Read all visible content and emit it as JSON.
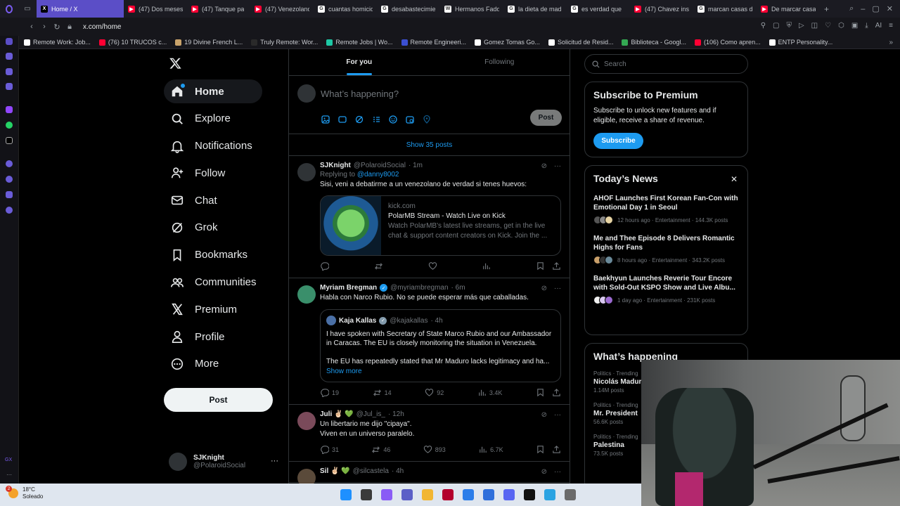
{
  "browser": {
    "tabs": [
      {
        "label": "Home / X",
        "color": "#000000",
        "glyph": "X",
        "active": true
      },
      {
        "label": "(47) Dos meses",
        "color": "#ff0033",
        "glyph": "▶",
        "active": false
      },
      {
        "label": "(47) Tanque pa",
        "color": "#ff0033",
        "glyph": "▶",
        "active": false
      },
      {
        "label": "(47) Venezolano",
        "color": "#ff0033",
        "glyph": "▶",
        "active": false
      },
      {
        "label": "cuantas homicid",
        "color": "#ffffff",
        "glyph": "G",
        "active": false
      },
      {
        "label": "desabastecimie",
        "color": "#ffffff",
        "glyph": "G",
        "active": false
      },
      {
        "label": "Hermanos Fadd",
        "color": "#ffffff",
        "glyph": "W",
        "active": false
      },
      {
        "label": "la dieta de mad",
        "color": "#ffffff",
        "glyph": "G",
        "active": false
      },
      {
        "label": "es verdad que",
        "color": "#ffffff",
        "glyph": "G",
        "active": false
      },
      {
        "label": "(47) Chavez ins",
        "color": "#ff0033",
        "glyph": "▶",
        "active": false
      },
      {
        "label": "marcan casas d",
        "color": "#ffffff",
        "glyph": "G",
        "active": false
      },
      {
        "label": "De marcar casas",
        "color": "#ff0033",
        "glyph": "▶",
        "active": false
      }
    ],
    "url": "x.com/home",
    "bookmarks": [
      {
        "label": "Remote Work: Job...",
        "color": "#ffffff"
      },
      {
        "label": "(76) 10 TRUCOS c...",
        "color": "#ff0033"
      },
      {
        "label": "19 Divine French L...",
        "color": "#c9a36b"
      },
      {
        "label": "Truly Remote: Wor...",
        "color": "#2a2a2a"
      },
      {
        "label": "Remote Jobs | Wo...",
        "color": "#1ec8a5"
      },
      {
        "label": "Remote Engineeri...",
        "color": "#3b4fd1"
      },
      {
        "label": "Gomez Tomas Go...",
        "color": "#ffffff"
      },
      {
        "label": "Solicitud de Resid...",
        "color": "#ffffff"
      },
      {
        "label": "Biblioteca - Googl...",
        "color": "#34a853"
      },
      {
        "label": "(106) Como apren...",
        "color": "#ff0033"
      },
      {
        "label": "ENTP Personality...",
        "color": "#ffffff"
      }
    ]
  },
  "nav": {
    "items": [
      {
        "label": "Home",
        "icon": "home-icon",
        "active": true,
        "dot": true
      },
      {
        "label": "Explore",
        "icon": "search-icon"
      },
      {
        "label": "Notifications",
        "icon": "bell-icon"
      },
      {
        "label": "Follow",
        "icon": "person-plus-icon"
      },
      {
        "label": "Chat",
        "icon": "mail-icon"
      },
      {
        "label": "Grok",
        "icon": "grok-icon"
      },
      {
        "label": "Bookmarks",
        "icon": "bookmark-icon"
      },
      {
        "label": "Communities",
        "icon": "people-icon"
      },
      {
        "label": "Premium",
        "icon": "x-icon"
      },
      {
        "label": "Profile",
        "icon": "person-icon"
      },
      {
        "label": "More",
        "icon": "more-circle-icon"
      }
    ],
    "post_label": "Post",
    "account": {
      "name": "SJKnight",
      "handle": "@PolaroidSocial",
      "more": "···"
    }
  },
  "feed": {
    "tabs": [
      "For you",
      "Following"
    ],
    "composer": {
      "placeholder": "What’s happening?",
      "post_label": "Post"
    },
    "show_more": "Show 35 posts",
    "posts": [
      {
        "name": "SJKnight",
        "handle": "@PolaroidSocial",
        "time": "· 1m",
        "avatar": "#2f3336",
        "reply_prefix": "Replying to ",
        "reply_to": "@danny8002",
        "text": "Sisi, veni a debatirme a un venezolano de verdad si tenes huevos:",
        "card": {
          "domain": "kick.com",
          "title": "PolarMB Stream - Watch Live on Kick",
          "desc": "Watch PolarMB's latest live streams, get in the live chat & support content creators on Kick. Join the ..."
        },
        "stats": {
          "reply": "",
          "repost": "",
          "like": "",
          "views": ""
        }
      },
      {
        "name": "Myriam Bregman",
        "handle": "@myriambregman",
        "time": "· 6m",
        "avatar": "#3a8f6b",
        "verified": true,
        "text": "Habla con Narco Rubio. No se puede esperar más que caballadas.",
        "quote": {
          "name": "Kaja Kallas",
          "handle": "@kajakallas",
          "time": "· 4h",
          "text1": "I have spoken with Secretary of State Marco Rubio and our Ambassador in Caracas. The EU is closely monitoring the situation in Venezuela.",
          "text2": "The EU has repeatedly stated that Mr Maduro lacks legitimacy and ha...",
          "more": "Show more"
        },
        "stats": {
          "reply": "19",
          "repost": "14",
          "like": "92",
          "views": "3.4K"
        }
      },
      {
        "name": "Juli ✌🏻 💚",
        "handle": "@Jul_is_",
        "time": "· 12h",
        "avatar": "#7a4a5a",
        "text": "Un libertario me dijo \"cipaya\".",
        "text2": "Viven en un universo paralelo.",
        "stats": {
          "reply": "31",
          "repost": "46",
          "like": "893",
          "views": "6.7K"
        }
      },
      {
        "name": "Sil ✌🏻 💚",
        "handle": "@silcastela",
        "time": "· 4h",
        "avatar": "#5a4a3a",
        "text": ""
      }
    ]
  },
  "right": {
    "search_placeholder": "Search",
    "premium": {
      "title": "Subscribe to Premium",
      "text": "Subscribe to unlock new features and if eligible, receive a share of revenue.",
      "button": "Subscribe"
    },
    "news": {
      "title": "Today’s News",
      "items": [
        {
          "title": "AHOF Launches First Korean Fan-Con with Emotional Day 1 in Seoul",
          "meta": "12 hours ago · Entertainment · 144.3K posts",
          "avatars": [
            "#555",
            "#888",
            "#e6d3a3"
          ]
        },
        {
          "title": "Me and Thee Episode 8 Delivers Romantic Highs for Fans",
          "meta": "8 hours ago · Entertainment · 343.2K posts",
          "avatars": [
            "#c9a06a",
            "#333",
            "#6a8a9a"
          ]
        },
        {
          "title": "Baekhyun Launches Reverie Tour Encore with Sold-Out KSPO Show and Live Albu...",
          "meta": "1 day ago · Entertainment · 231K posts",
          "avatars": [
            "#f0f0f0",
            "#d8c8f0",
            "#9b6ad0"
          ]
        }
      ]
    },
    "happening": {
      "title": "What’s happening",
      "trends": [
        {
          "category": "Politics · Trending",
          "name": "Nicolás Maduro",
          "posts": "1.14M posts"
        },
        {
          "category": "Politics · Trending",
          "name": "Mr. President",
          "posts": "56.6K posts"
        },
        {
          "category": "Politics · Trending",
          "name": "Palestina",
          "posts": "73.5K posts"
        }
      ]
    }
  },
  "taskbar": {
    "weather_temp": "18°C",
    "weather_desc": "Soleado",
    "badge": "2",
    "apps": [
      "#1e90ff",
      "#3a3a3a",
      "#8a5cf6",
      "#5b5fc7",
      "#f2b632",
      "#b3002d",
      "#2b7de9",
      "#2f6fdb",
      "#5865f2",
      "#111111",
      "#2aa3e2",
      "#6b6b6b"
    ]
  }
}
